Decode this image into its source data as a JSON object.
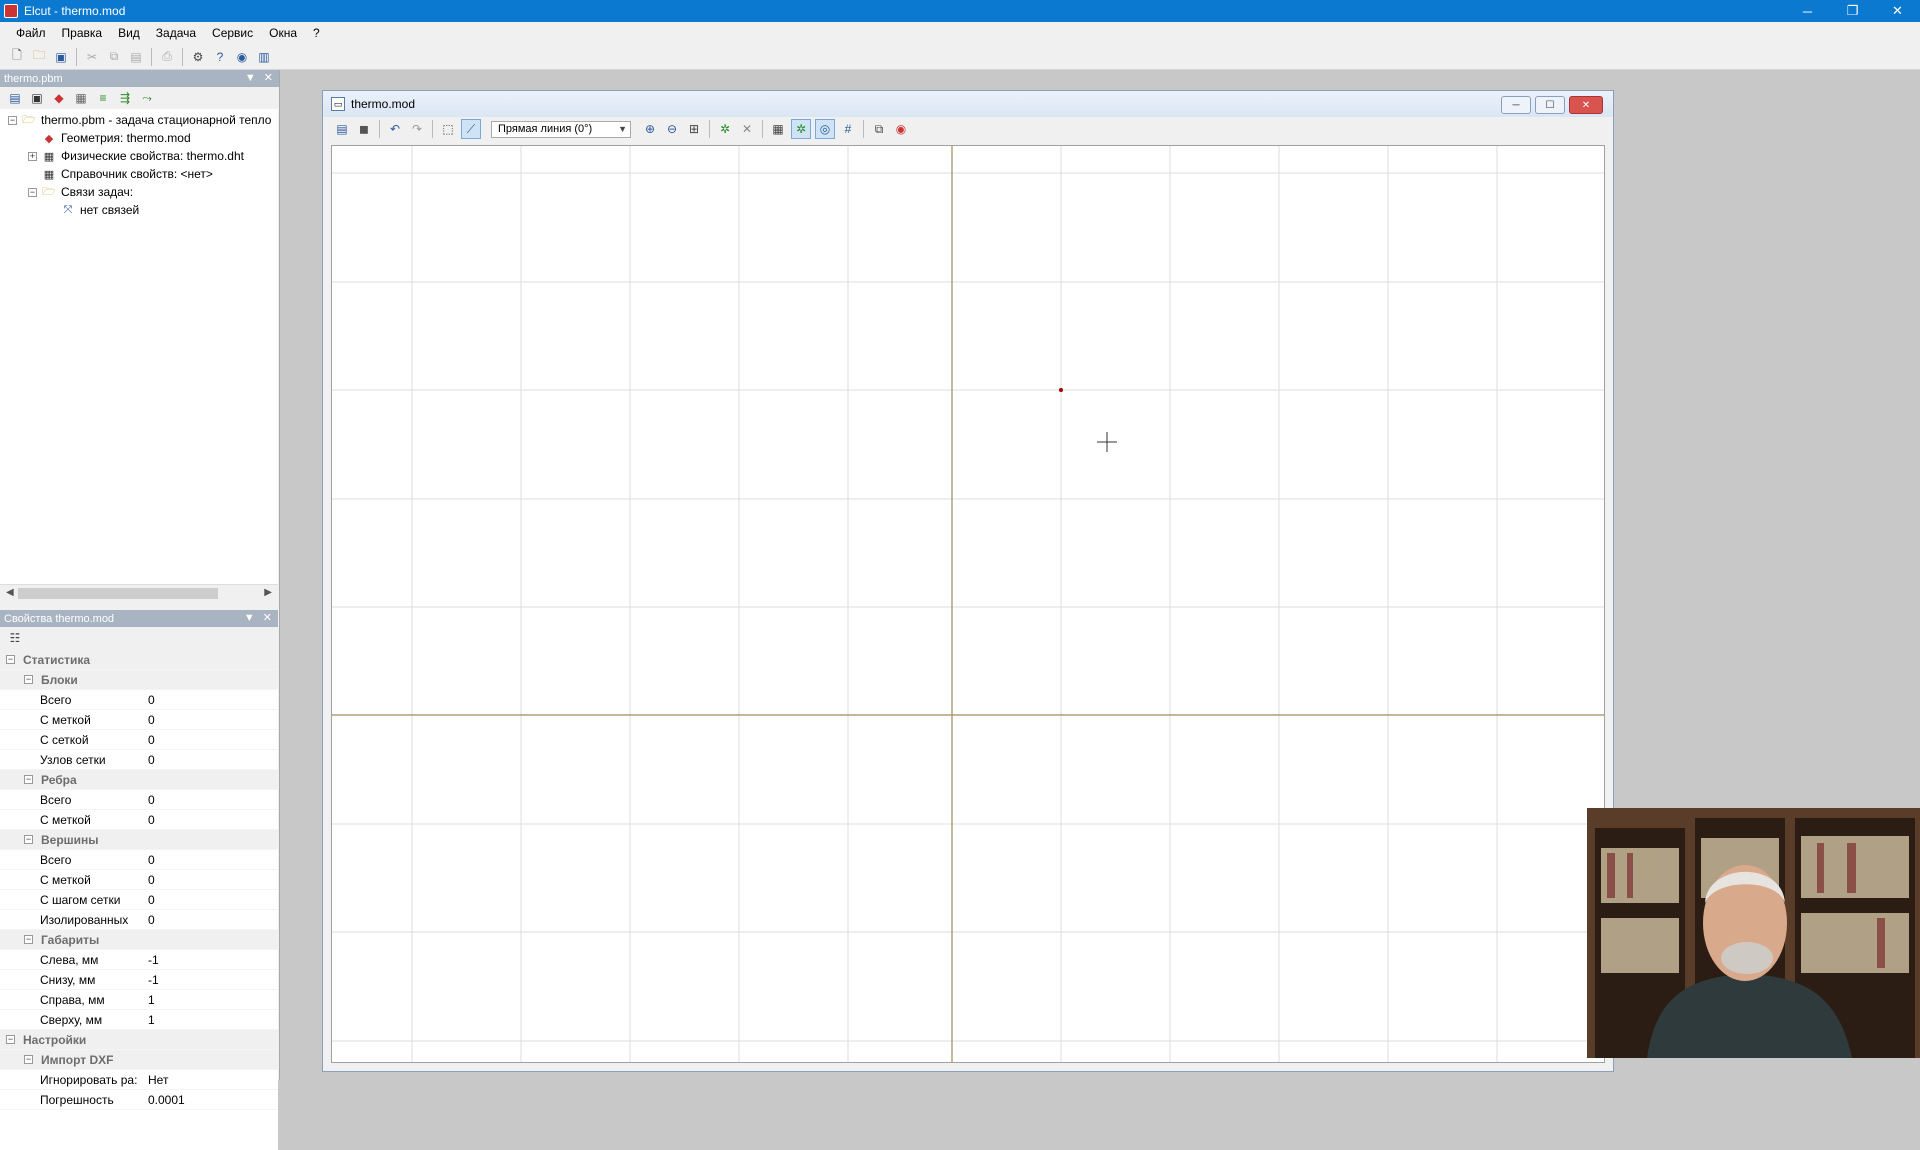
{
  "window": {
    "title": "Elcut - thermo.mod"
  },
  "menu": [
    "Файл",
    "Правка",
    "Вид",
    "Задача",
    "Сервис",
    "Окна",
    "?"
  ],
  "problem_panel": {
    "title": "thermo.pbm",
    "tree": [
      {
        "label": "thermo.pbm - задача стационарной тепло",
        "icon": "folder-open-icon",
        "indent": 0,
        "expander": "−"
      },
      {
        "label": "Геометрия: thermo.mod",
        "icon": "geometry-icon",
        "indent": 1,
        "expander": ""
      },
      {
        "label": "Физические свойства: thermo.dht",
        "icon": "table-icon",
        "indent": 1,
        "expander": "+"
      },
      {
        "label": "Справочник свойств: <нет>",
        "icon": "table-icon",
        "indent": 1,
        "expander": ""
      },
      {
        "label": "Связи задач:",
        "icon": "folder-open-icon",
        "indent": 1,
        "expander": "−"
      },
      {
        "label": "нет связей",
        "icon": "link-icon",
        "indent": 2,
        "expander": ""
      }
    ]
  },
  "properties_panel": {
    "title": "Свойства thermo.mod",
    "rows": [
      {
        "type": "cat",
        "level": 0,
        "name": "Статистика"
      },
      {
        "type": "cat",
        "level": 1,
        "name": "Блоки"
      },
      {
        "type": "prop",
        "name": "Всего",
        "value": "0"
      },
      {
        "type": "prop",
        "name": "С меткой",
        "value": "0"
      },
      {
        "type": "prop",
        "name": "С сеткой",
        "value": "0"
      },
      {
        "type": "prop",
        "name": "Узлов сетки",
        "value": "0"
      },
      {
        "type": "cat",
        "level": 1,
        "name": "Ребра"
      },
      {
        "type": "prop",
        "name": "Всего",
        "value": "0"
      },
      {
        "type": "prop",
        "name": "С меткой",
        "value": "0"
      },
      {
        "type": "cat",
        "level": 1,
        "name": "Вершины"
      },
      {
        "type": "prop",
        "name": "Всего",
        "value": "0"
      },
      {
        "type": "prop",
        "name": "С меткой",
        "value": "0"
      },
      {
        "type": "prop",
        "name": "С шагом сетки",
        "value": "0"
      },
      {
        "type": "prop",
        "name": "Изолированных",
        "value": "0"
      },
      {
        "type": "cat",
        "level": 1,
        "name": "Габариты"
      },
      {
        "type": "prop",
        "name": "Слева, мм",
        "value": "-1"
      },
      {
        "type": "prop",
        "name": "Снизу, мм",
        "value": "-1"
      },
      {
        "type": "prop",
        "name": "Справа, мм",
        "value": "1"
      },
      {
        "type": "prop",
        "name": "Сверху, мм",
        "value": "1"
      },
      {
        "type": "cat",
        "level": 0,
        "name": "Настройки"
      },
      {
        "type": "cat",
        "level": 1,
        "name": "Импорт DXF"
      },
      {
        "type": "prop",
        "name": "Игнорировать ра:",
        "value": "Нет"
      },
      {
        "type": "prop",
        "name": "Погрешность",
        "value": "0.0001"
      }
    ]
  },
  "model_window": {
    "title": "thermo.mod",
    "draw_mode": "Прямая линия (0°)"
  },
  "colors": {
    "titlebar": "#0b79d0",
    "axis": "#a08a5a",
    "grid": "#dcdcdc",
    "point": "#a00000"
  }
}
